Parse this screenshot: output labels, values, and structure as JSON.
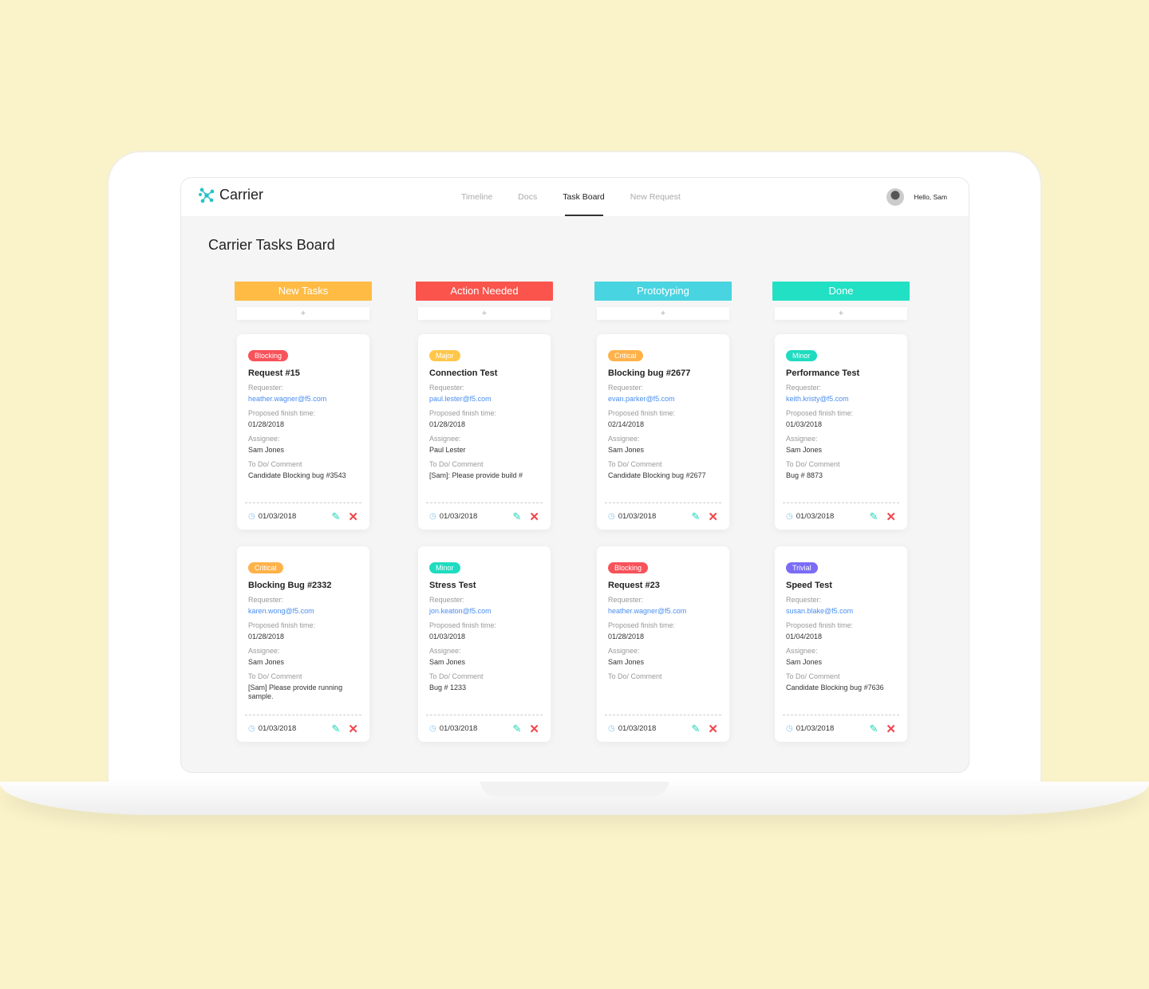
{
  "app": {
    "name": "Carrier",
    "user_greeting": "Hello, Sam"
  },
  "nav": [
    {
      "label": "Timeline"
    },
    {
      "label": "Docs"
    },
    {
      "label": "Task Board",
      "active": true
    },
    {
      "label": "New Request"
    }
  ],
  "page_title": "Carrier Tasks Board",
  "labels": {
    "requester": "Requester:",
    "finish": "Proposed finish time:",
    "assignee": "Assignee:",
    "comment": "To Do/ Comment",
    "add": "+"
  },
  "tag_colors": {
    "Blocking": "#f8525a",
    "Major": "#ffc74a",
    "Critical": "#ffb24a",
    "Minor": "#1fdcc0",
    "Trivial": "#7b6cf6"
  },
  "columns": [
    {
      "title": "New Tasks",
      "color": "#ffbb44",
      "cards": [
        {
          "tag": "Blocking",
          "title": "Request #15",
          "requester": "heather.wagner@f5.com",
          "finish": "01/28/2018",
          "assignee": "Sam Jones",
          "comment": "Candidate Blocking bug #3543",
          "date": "01/03/2018"
        },
        {
          "tag": "Critical",
          "title": "Blocking Bug #2332",
          "requester": "karen.wong@f5.com",
          "finish": "01/28/2018",
          "assignee": "Sam Jones",
          "comment": "[Sam] Please provide running sample.",
          "date": "01/03/2018"
        }
      ]
    },
    {
      "title": "Action Needed",
      "color": "#fa544c",
      "cards": [
        {
          "tag": "Major",
          "title": "Connection Test",
          "requester": "paul.lester@f5.com",
          "finish": "01/28/2018",
          "assignee": "Paul Lester",
          "comment": "[Sam]: Please provide build #",
          "date": "01/03/2018"
        },
        {
          "tag": "Minor",
          "title": "Stress Test",
          "requester": "jon.keaton@f5.com",
          "finish": "01/03/2018",
          "assignee": "Sam Jones",
          "comment": "Bug # 1233",
          "date": "01/03/2018"
        }
      ]
    },
    {
      "title": "Prototyping",
      "color": "#48d4e0",
      "cards": [
        {
          "tag": "Critical",
          "title": "Blocking bug #2677",
          "requester": "evan.parker@f5.com",
          "finish": "02/14/2018",
          "assignee": "Sam Jones",
          "comment": "Candidate Blocking bug #2677",
          "date": "01/03/2018"
        },
        {
          "tag": "Blocking",
          "title": "Request #23",
          "requester": "heather.wagner@f5.com",
          "finish": "01/28/2018",
          "assignee": "Sam Jones",
          "comment": "",
          "date": "01/03/2018"
        }
      ]
    },
    {
      "title": "Done",
      "color": "#22e0c4",
      "cards": [
        {
          "tag": "Minor",
          "title": "Performance Test",
          "requester": "keith.kristy@f5.com",
          "finish": "01/03/2018",
          "assignee": "Sam Jones",
          "comment": "Bug # 8873",
          "date": "01/03/2018"
        },
        {
          "tag": "Trivial",
          "title": "Speed Test",
          "requester": "susan.blake@f5.com",
          "finish": "01/04/2018",
          "assignee": "Sam Jones",
          "comment": "Candidate Blocking bug #7636",
          "date": "01/03/2018"
        }
      ]
    }
  ]
}
